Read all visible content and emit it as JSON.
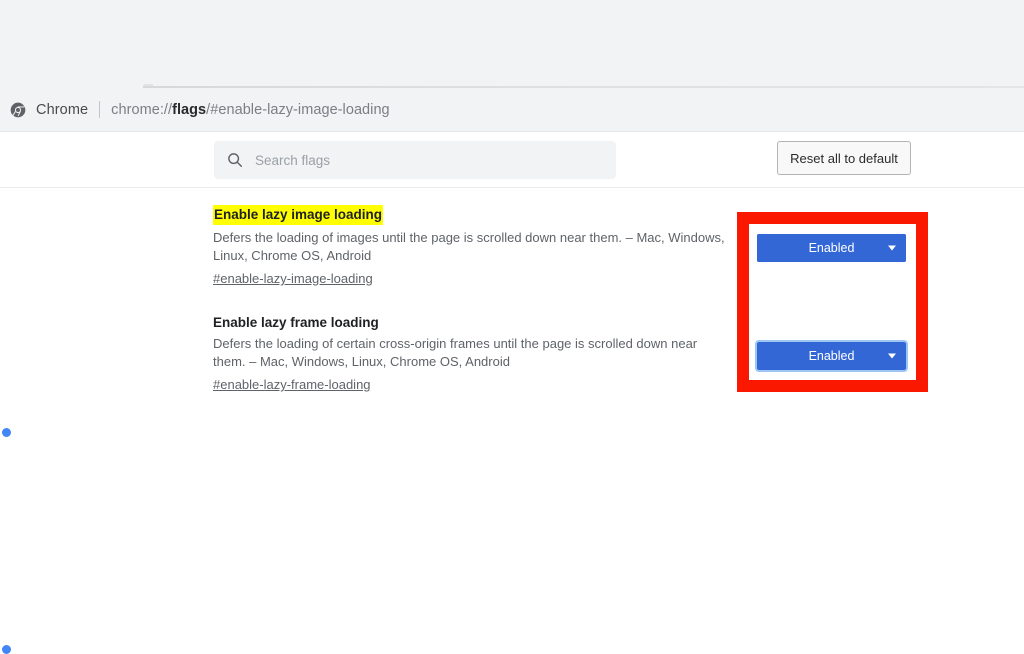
{
  "browser": {
    "app_name": "Chrome",
    "url_prefix": "chrome://",
    "url_bold": "flags",
    "url_suffix": "/#enable-lazy-image-loading",
    "logo_icon": "chrome-logo-icon"
  },
  "toolbar": {
    "search_placeholder": "Search flags",
    "search_value": "",
    "search_icon": "search-icon",
    "reset_label": "Reset all to default"
  },
  "flags": [
    {
      "title": "Enable lazy image loading",
      "highlighted": true,
      "description": "Defers the loading of images until the page is scrolled down near them. – Mac, Windows, Linux, Chrome OS, Android",
      "permalink": "#enable-lazy-image-loading",
      "select_value": "Enabled",
      "select_focused": false
    },
    {
      "title": "Enable lazy frame loading",
      "highlighted": false,
      "description": "Defers the loading of certain cross-origin frames until the page is scrolled down near them. – Mac, Windows, Linux, Chrome OS, Android",
      "permalink": "#enable-lazy-frame-loading",
      "select_value": "Enabled",
      "select_focused": true
    }
  ],
  "annotation": {
    "color": "#fa1800",
    "label": "red-highlight-box"
  },
  "colors": {
    "accent_blue": "#3367d6",
    "bullet_blue": "#4285f4",
    "highlight_yellow": "#ffff00",
    "chrome_bg": "#f1f3f4",
    "annotation_red": "#fa1800"
  }
}
